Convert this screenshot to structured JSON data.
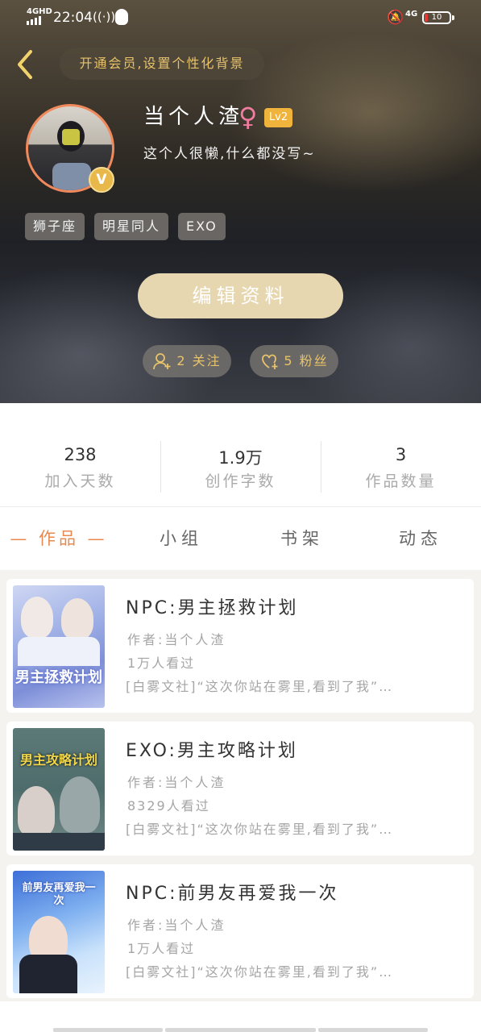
{
  "status_bar": {
    "signal_text": "4GHD",
    "time": "22:04",
    "network": "4G",
    "battery": "10",
    "icons": [
      "signal-icon",
      "nfc-wave-icon",
      "qq-icon",
      "mute-bell-icon",
      "battery-icon"
    ]
  },
  "header": {
    "vip_banner": "开通会员,设置个性化背景"
  },
  "profile": {
    "name": "当个人渣",
    "gender_symbol": "♀",
    "level": "Lv2",
    "vip_badge": "V",
    "bio": "这个人很懒,什么都没写~",
    "tags": [
      "狮子座",
      "明星同人",
      "EXO"
    ],
    "edit_button": "编辑资料",
    "follow_label": "2 关注",
    "fans_label": "5 粉丝"
  },
  "stats": [
    {
      "value": "238",
      "label": "加入天数"
    },
    {
      "value": "1.9万",
      "label": "创作字数"
    },
    {
      "value": "3",
      "label": "作品数量"
    }
  ],
  "tabs": [
    {
      "label": "— 作品 —",
      "active": true
    },
    {
      "label": "小组",
      "active": false
    },
    {
      "label": "书架",
      "active": false
    },
    {
      "label": "动态",
      "active": false
    }
  ],
  "works": [
    {
      "title": "NPC:男主拯救计划",
      "author": "作者:当个人渣",
      "views": "1万人看过",
      "desc": "[白雾文社]“这次你站在雾里,看到了我”…",
      "cover_text": "男主拯救计划"
    },
    {
      "title": "EXO:男主攻略计划",
      "author": "作者:当个人渣",
      "views": "8329人看过",
      "desc": "[白雾文社]“这次你站在雾里,看到了我”…",
      "cover_text": "男主攻略计划"
    },
    {
      "title": "NPC:前男友再爱我一次",
      "author": "作者:当个人渣",
      "views": "1万人看过",
      "desc": "[白雾文社]“这次你站在雾里,看到了我”…",
      "cover_text": "前男友再爱我一次"
    }
  ],
  "colors": {
    "accent": "#e88a4f",
    "gold_text": "#e8c36a",
    "edit_button": "#e6d7b0",
    "level_badge": "#f0b43c"
  }
}
